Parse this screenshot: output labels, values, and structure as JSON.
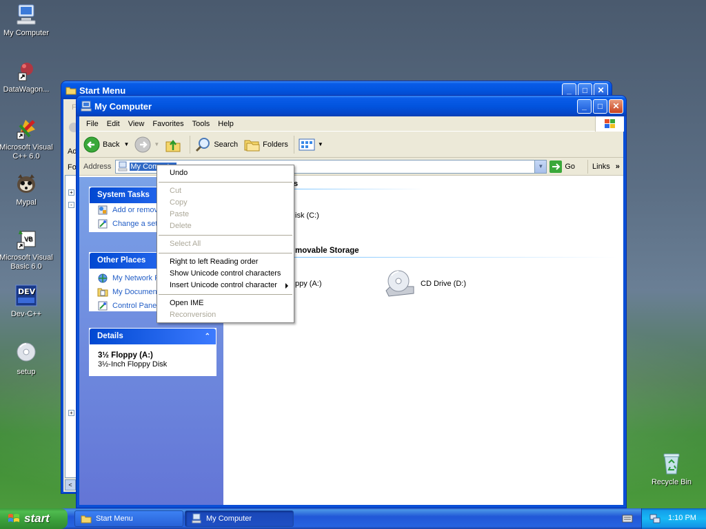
{
  "desktop": {
    "icons": [
      {
        "label": "My Computer",
        "icon": "my-computer-icon"
      },
      {
        "label": "DataWagon...",
        "icon": "shortcut-icon"
      },
      {
        "label": "Microsoft Visual C++ 6.0",
        "icon": "visual-cpp-icon"
      },
      {
        "label": "Mypal",
        "icon": "mypal-icon"
      },
      {
        "label": "Microsoft Visual Basic 6.0",
        "icon": "visual-basic-icon"
      },
      {
        "label": "Dev-C++",
        "icon": "dev-cpp-icon"
      },
      {
        "label": "setup",
        "icon": "cd-icon"
      },
      {
        "label": "Recycle Bin",
        "icon": "recycle-bin-icon"
      }
    ]
  },
  "back_window": {
    "title": "Start Menu",
    "partial_menu_fragment": "F",
    "address_fragment": "Ad",
    "folders_fragment": "Fo"
  },
  "window": {
    "title": "My Computer",
    "menu": [
      "File",
      "Edit",
      "View",
      "Favorites",
      "Tools",
      "Help"
    ],
    "toolbar": {
      "back": "Back",
      "search": "Search",
      "folders": "Folders"
    },
    "address_label": "Address",
    "address_value": "My Computer",
    "go_label": "Go",
    "links_label": "Links"
  },
  "task_pane": {
    "system_tasks": {
      "header": "System Tasks",
      "items": [
        "Add or remove programs",
        "Change a setting"
      ]
    },
    "other_places": {
      "header": "Other Places",
      "items": [
        "My Network Places",
        "My Documents",
        "Control Panel"
      ]
    },
    "details": {
      "header": "Details",
      "name": "3½ Floppy (A:)",
      "description": "3½-Inch Floppy Disk"
    }
  },
  "content": {
    "section1_fragment": "s",
    "local_disk_fragment": "isk (C:)",
    "section2_fragment": "movable Storage",
    "floppy_fragment": "ppy (A:)",
    "cd_drive": "CD Drive (D:)"
  },
  "context_menu": {
    "items": [
      {
        "label": "Undo",
        "enabled": true
      },
      {
        "sep": true
      },
      {
        "label": "Cut",
        "enabled": false
      },
      {
        "label": "Copy",
        "enabled": false
      },
      {
        "label": "Paste",
        "enabled": false
      },
      {
        "label": "Delete",
        "enabled": false
      },
      {
        "sep": true
      },
      {
        "label": "Select All",
        "enabled": false
      },
      {
        "sep": true
      },
      {
        "label": "Right to left Reading order",
        "enabled": true
      },
      {
        "label": "Show Unicode control characters",
        "enabled": true
      },
      {
        "label": "Insert Unicode control character",
        "enabled": true,
        "submenu": true
      },
      {
        "sep": true
      },
      {
        "label": "Open IME",
        "enabled": true
      },
      {
        "label": "Reconversion",
        "enabled": false
      }
    ]
  },
  "taskbar": {
    "start_label": "start",
    "buttons": [
      "Start Menu",
      "My Computer"
    ],
    "clock": "1:10 PM"
  }
}
